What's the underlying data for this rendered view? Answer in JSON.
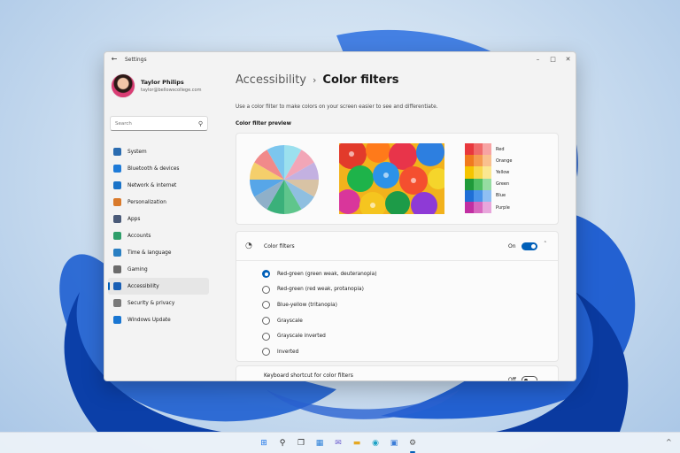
{
  "window": {
    "title": "Settings",
    "back_icon": "back-arrow-icon",
    "controls": [
      "minimize-icon",
      "maximize-icon",
      "close-icon"
    ]
  },
  "profile": {
    "name": "Taylor Philips",
    "email": "taylor@bellowscollege.com"
  },
  "search": {
    "placeholder": "Search",
    "icon": "search-icon"
  },
  "sidebar": {
    "items": [
      {
        "label": "System",
        "icon": "monitor-icon",
        "color": "#2b6cb0"
      },
      {
        "label": "Bluetooth & devices",
        "icon": "bluetooth-icon",
        "color": "#1e7bd8"
      },
      {
        "label": "Network & internet",
        "icon": "wifi-icon",
        "color": "#1a73c8"
      },
      {
        "label": "Personalization",
        "icon": "brush-icon",
        "color": "#d97a2b"
      },
      {
        "label": "Apps",
        "icon": "apps-icon",
        "color": "#4a5a78"
      },
      {
        "label": "Accounts",
        "icon": "person-icon",
        "color": "#2f9e6a"
      },
      {
        "label": "Time & language",
        "icon": "globe-clock-icon",
        "color": "#2a7fc2"
      },
      {
        "label": "Gaming",
        "icon": "gamepad-icon",
        "color": "#6b6b6b"
      },
      {
        "label": "Accessibility",
        "icon": "accessibility-icon",
        "color": "#1a5fb4",
        "active": true
      },
      {
        "label": "Security & privacy",
        "icon": "shield-icon",
        "color": "#7a7a7a"
      },
      {
        "label": "Windows Update",
        "icon": "refresh-icon",
        "color": "#1976d2"
      }
    ]
  },
  "main": {
    "breadcrumb_parent": "Accessibility",
    "breadcrumb_separator": "›",
    "breadcrumb_current": "Color filters",
    "description": "Use a color filter to make colors on your screen easier to see and differentiate.",
    "preview_label": "Color filter preview",
    "pie_colors": [
      "#9be0ee",
      "#f2a6b7",
      "#c3b1e1",
      "#d8c3a5",
      "#8fbfe0",
      "#5fc58c",
      "#3ab07a",
      "#8fb0c9",
      "#57a6e8",
      "#f5cf6b",
      "#f18a8a",
      "#7cc6ee"
    ],
    "swatches": [
      {
        "name": "Red",
        "colors": [
          "#e8383d",
          "#f06a6a",
          "#f7a3a3"
        ]
      },
      {
        "name": "Orange",
        "colors": [
          "#f07a1e",
          "#f59b4f",
          "#f9c08f"
        ]
      },
      {
        "name": "Yellow",
        "colors": [
          "#f5c400",
          "#f8d84c",
          "#fbe791"
        ]
      },
      {
        "name": "Green",
        "colors": [
          "#1f9a3a",
          "#4fbf63",
          "#95dca1"
        ]
      },
      {
        "name": "Blue",
        "colors": [
          "#1f6fd6",
          "#4a94ea",
          "#8fbff3"
        ]
      },
      {
        "name": "Purple",
        "colors": [
          "#c12fa2",
          "#d868bf",
          "#e8a6dc"
        ]
      }
    ],
    "filters": {
      "label": "Color filters",
      "icon": "color-filter-icon",
      "state": "On",
      "chevron": "chevron-up-icon",
      "options": [
        {
          "label": "Red-green (green weak, deuteranopia)",
          "selected": true
        },
        {
          "label": "Red-green (red weak, protanopia)",
          "selected": false
        },
        {
          "label": "Blue-yellow (tritanopia)",
          "selected": false
        },
        {
          "label": "Grayscale",
          "selected": false
        },
        {
          "label": "Grayscale inverted",
          "selected": false
        },
        {
          "label": "Inverted",
          "selected": false
        }
      ]
    },
    "keyboard": {
      "title": "Keyboard shortcut for color filters",
      "state": "Off"
    }
  },
  "taskbar": {
    "icons": [
      {
        "name": "start-icon",
        "glyph": "⊞",
        "color": "#1a73e8"
      },
      {
        "name": "search-icon",
        "glyph": "⚲",
        "color": "#222"
      },
      {
        "name": "task-view-icon",
        "glyph": "❐",
        "color": "#333"
      },
      {
        "name": "widgets-icon",
        "glyph": "▦",
        "color": "#2a7fd8"
      },
      {
        "name": "chat-icon",
        "glyph": "✉",
        "color": "#6a5acd"
      },
      {
        "name": "file-explorer-icon",
        "glyph": "▬",
        "color": "#e5a823"
      },
      {
        "name": "edge-icon",
        "glyph": "◉",
        "color": "#1da1c4"
      },
      {
        "name": "store-icon",
        "glyph": "▣",
        "color": "#3b7dd8"
      },
      {
        "name": "settings-icon",
        "glyph": "⚙",
        "color": "#555",
        "running": true
      }
    ],
    "tray_chevron": "^"
  }
}
